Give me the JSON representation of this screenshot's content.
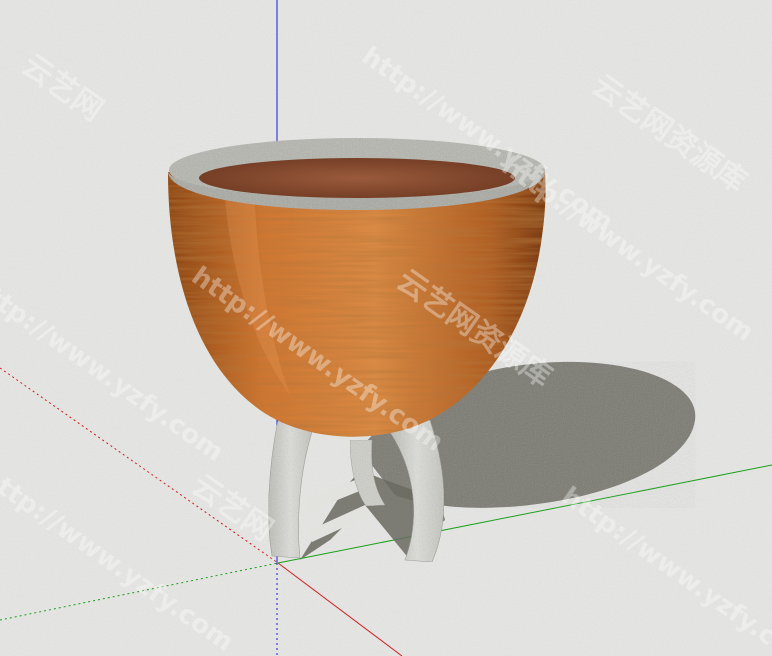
{
  "viewport": {
    "background_color": "#e8e8e6",
    "axis_colors": {
      "blue": "#1a1ad8",
      "red": "#d21c1c",
      "green": "#18a018"
    }
  },
  "model": {
    "body_color": "#c06a2a",
    "rim_color": "#b8b8b2",
    "soil_color": "#8a4e32",
    "stand_color": "#d6d6d0",
    "shadow_color": "#6a6a60"
  },
  "watermark": {
    "texts": [
      "http://www.yzfy.com",
      "云艺网",
      "云艺网资源库"
    ],
    "color": "#ffffff"
  }
}
